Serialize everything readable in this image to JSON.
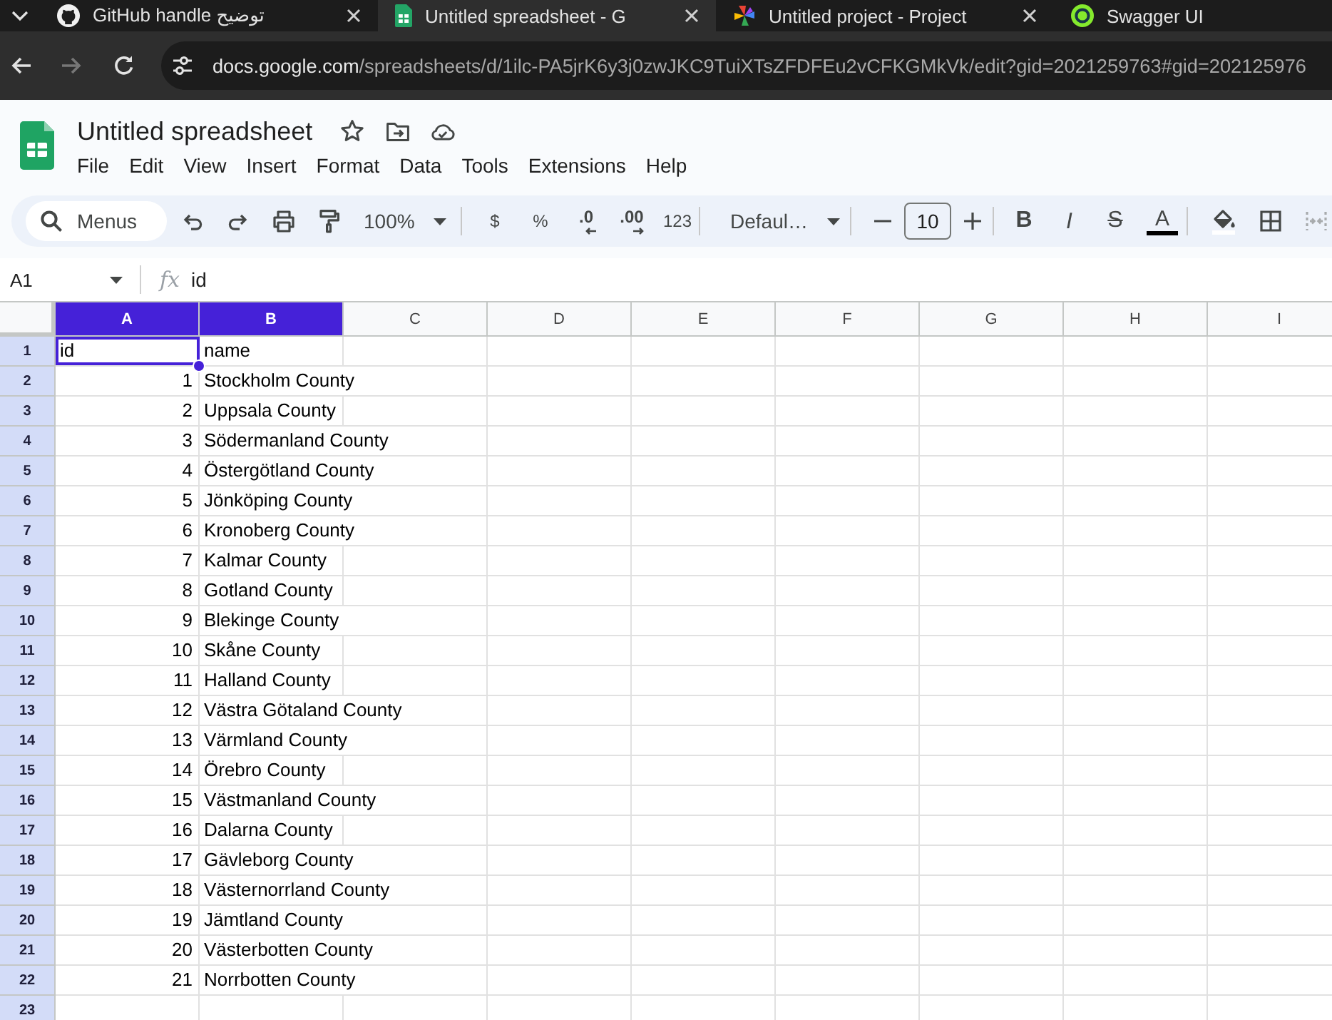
{
  "browser": {
    "tabs": [
      {
        "title": "GitHub handle توضيح",
        "selected": false
      },
      {
        "title": "Untitled spreadsheet - G",
        "selected": true
      },
      {
        "title": "Untitled project - Project",
        "selected": false
      },
      {
        "title": "Swagger UI",
        "selected": false
      }
    ],
    "navigation": {
      "back_enabled": true,
      "forward_enabled": false
    },
    "address": {
      "domain": "docs.google.com",
      "path": "/spreadsheets/d/1ilc-PA5jrK6y3j0zwJKC9TuiXTsZFDFEu2vCFKGMkVk/edit?gid=2021259763#gid=202125976"
    }
  },
  "document": {
    "title": "Untitled spreadsheet",
    "starred": false
  },
  "menu": [
    "File",
    "Edit",
    "View",
    "Insert",
    "Format",
    "Data",
    "Tools",
    "Extensions",
    "Help"
  ],
  "toolbar": {
    "search": "Menus",
    "zoom": "100%",
    "currency": "$",
    "percent": "%",
    "decrease_decimals": ".0",
    "increase_decimals": ".00",
    "number_format": "123",
    "font": "Defaul…",
    "font_size": "10",
    "bold": "B",
    "italic": "I",
    "strikethrough": "S",
    "text_color": "A"
  },
  "formula_bar": {
    "cell": "A1",
    "function_label": "fx",
    "value": "id"
  },
  "sheet": {
    "columns": [
      {
        "label": "A",
        "selected": true
      },
      {
        "label": "B",
        "selected": true
      },
      {
        "label": "C",
        "selected": false
      },
      {
        "label": "D",
        "selected": false
      },
      {
        "label": "E",
        "selected": false
      },
      {
        "label": "F",
        "selected": false
      },
      {
        "label": "G",
        "selected": false
      },
      {
        "label": "H",
        "selected": false
      },
      {
        "label": "I",
        "selected": false
      }
    ],
    "rows": [
      {
        "number": "1",
        "highlighted": true,
        "cells": [
          {
            "value": "id",
            "kind": "text",
            "active": true
          },
          {
            "value": "name",
            "kind": "text",
            "active": false
          }
        ]
      },
      {
        "number": "2",
        "highlighted": true,
        "cells": [
          {
            "value": "1",
            "kind": "number",
            "active": false
          },
          {
            "value": "Stockholm County",
            "kind": "text",
            "active": false
          }
        ]
      },
      {
        "number": "3",
        "highlighted": true,
        "cells": [
          {
            "value": "2",
            "kind": "number",
            "active": false
          },
          {
            "value": "Uppsala County",
            "kind": "text",
            "active": false
          }
        ]
      },
      {
        "number": "4",
        "highlighted": true,
        "cells": [
          {
            "value": "3",
            "kind": "number",
            "active": false
          },
          {
            "value": "Södermanland County",
            "kind": "text",
            "active": false
          }
        ]
      },
      {
        "number": "5",
        "highlighted": true,
        "cells": [
          {
            "value": "4",
            "kind": "number",
            "active": false
          },
          {
            "value": "Östergötland County",
            "kind": "text",
            "active": false
          }
        ]
      },
      {
        "number": "6",
        "highlighted": true,
        "cells": [
          {
            "value": "5",
            "kind": "number",
            "active": false
          },
          {
            "value": "Jönköping County",
            "kind": "text",
            "active": false
          }
        ]
      },
      {
        "number": "7",
        "highlighted": true,
        "cells": [
          {
            "value": "6",
            "kind": "number",
            "active": false
          },
          {
            "value": "Kronoberg County",
            "kind": "text",
            "active": false
          }
        ]
      },
      {
        "number": "8",
        "highlighted": true,
        "cells": [
          {
            "value": "7",
            "kind": "number",
            "active": false
          },
          {
            "value": "Kalmar County",
            "kind": "text",
            "active": false
          }
        ]
      },
      {
        "number": "9",
        "highlighted": true,
        "cells": [
          {
            "value": "8",
            "kind": "number",
            "active": false
          },
          {
            "value": "Gotland County",
            "kind": "text",
            "active": false
          }
        ]
      },
      {
        "number": "10",
        "highlighted": true,
        "cells": [
          {
            "value": "9",
            "kind": "number",
            "active": false
          },
          {
            "value": "Blekinge County",
            "kind": "text",
            "active": false
          }
        ]
      },
      {
        "number": "11",
        "highlighted": true,
        "cells": [
          {
            "value": "10",
            "kind": "number",
            "active": false
          },
          {
            "value": "Skåne County",
            "kind": "text",
            "active": false
          }
        ]
      },
      {
        "number": "12",
        "highlighted": true,
        "cells": [
          {
            "value": "11",
            "kind": "number",
            "active": false
          },
          {
            "value": "Halland County",
            "kind": "text",
            "active": false
          }
        ]
      },
      {
        "number": "13",
        "highlighted": true,
        "cells": [
          {
            "value": "12",
            "kind": "number",
            "active": false
          },
          {
            "value": "Västra Götaland County",
            "kind": "text",
            "active": false
          }
        ]
      },
      {
        "number": "14",
        "highlighted": true,
        "cells": [
          {
            "value": "13",
            "kind": "number",
            "active": false
          },
          {
            "value": "Värmland County",
            "kind": "text",
            "active": false
          }
        ]
      },
      {
        "number": "15",
        "highlighted": true,
        "cells": [
          {
            "value": "14",
            "kind": "number",
            "active": false
          },
          {
            "value": "Örebro County",
            "kind": "text",
            "active": false
          }
        ]
      },
      {
        "number": "16",
        "highlighted": true,
        "cells": [
          {
            "value": "15",
            "kind": "number",
            "active": false
          },
          {
            "value": "Västmanland County",
            "kind": "text",
            "active": false
          }
        ]
      },
      {
        "number": "17",
        "highlighted": true,
        "cells": [
          {
            "value": "16",
            "kind": "number",
            "active": false
          },
          {
            "value": "Dalarna County",
            "kind": "text",
            "active": false
          }
        ]
      },
      {
        "number": "18",
        "highlighted": true,
        "cells": [
          {
            "value": "17",
            "kind": "number",
            "active": false
          },
          {
            "value": "Gävleborg County",
            "kind": "text",
            "active": false
          }
        ]
      },
      {
        "number": "19",
        "highlighted": true,
        "cells": [
          {
            "value": "18",
            "kind": "number",
            "active": false
          },
          {
            "value": "Västernorrland County",
            "kind": "text",
            "active": false
          }
        ]
      },
      {
        "number": "20",
        "highlighted": true,
        "cells": [
          {
            "value": "19",
            "kind": "number",
            "active": false
          },
          {
            "value": "Jämtland County",
            "kind": "text",
            "active": false
          }
        ]
      },
      {
        "number": "21",
        "highlighted": true,
        "cells": [
          {
            "value": "20",
            "kind": "number",
            "active": false
          },
          {
            "value": "Västerbotten County",
            "kind": "text",
            "active": false
          }
        ]
      },
      {
        "number": "22",
        "highlighted": true,
        "cells": [
          {
            "value": "21",
            "kind": "number",
            "active": false
          },
          {
            "value": "Norrbotten County",
            "kind": "text",
            "active": false
          }
        ]
      },
      {
        "number": "23",
        "highlighted": true
      }
    ]
  }
}
